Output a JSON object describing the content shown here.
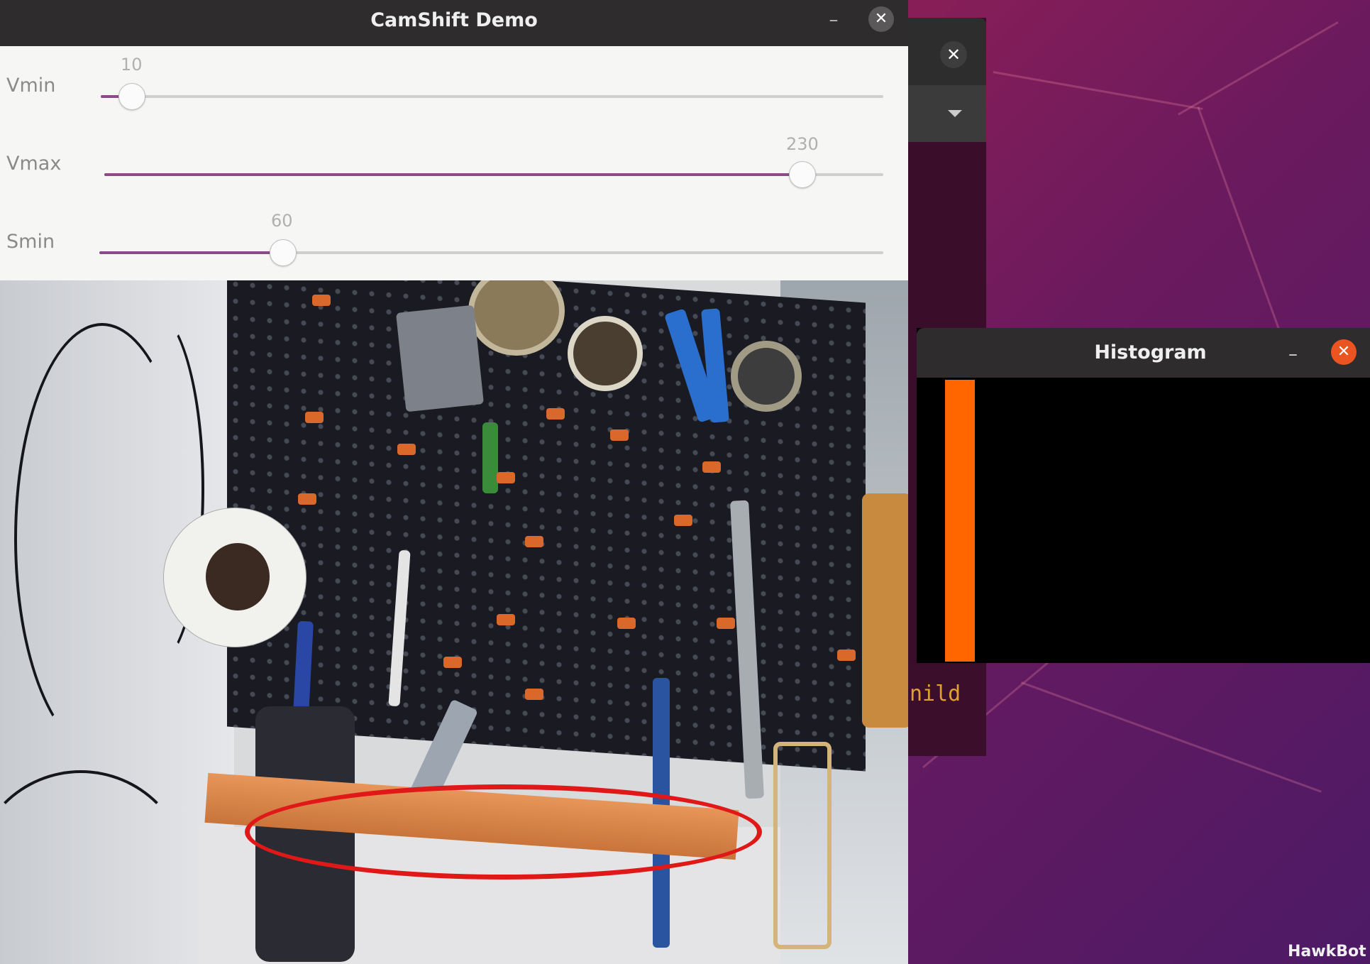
{
  "main_window": {
    "title": "CamShift Demo",
    "minimize_label": "–",
    "close_label": "✕"
  },
  "sliders": [
    {
      "label": "Vmin",
      "value": "10",
      "fraction": 0.04
    },
    {
      "label": "Vmax",
      "value": "230",
      "fraction": 0.9
    },
    {
      "label": "Smin",
      "value": "60",
      "fraction": 0.235
    }
  ],
  "histogram_window": {
    "title": "Histogram",
    "minimize_label": "–",
    "close_label": "✕",
    "bar_color": "#ff6600"
  },
  "terminal": {
    "close_label": "✕",
    "visible_text": "nild"
  },
  "watermark": "HawkBot",
  "colors": {
    "accent_purple": "#8c4a8b",
    "tracking_ellipse": "#e01818",
    "ubuntu_orange": "#e95420"
  }
}
